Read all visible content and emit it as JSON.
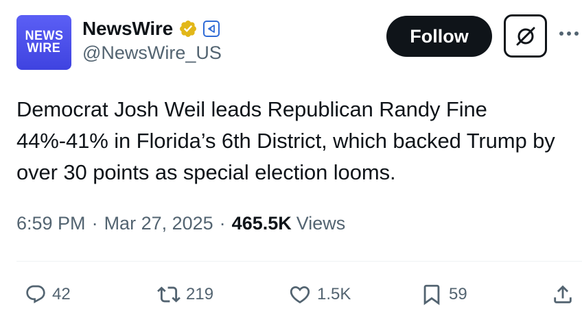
{
  "account": {
    "avatar_line1": "NEWS",
    "avatar_line2": "WIRE",
    "display_name": "NewsWire",
    "handle": "@NewsWire_US",
    "verified_badge": "gold-check-icon",
    "affiliate_badge": "affiliate-icon"
  },
  "header": {
    "follow_label": "Follow",
    "grok_icon": "grok-icon",
    "more_icon": "more-icon"
  },
  "tweet": {
    "text": "Democrat Josh Weil leads Republican Randy Fine 44%-41% in Florida’s 6th District, which backed Trump by over 30 points as special election looms.",
    "time": "6:59 PM",
    "separator": "·",
    "date": "Mar 27, 2025",
    "views_count": "465.5K",
    "views_label": "Views"
  },
  "actions": {
    "replies": "42",
    "reposts": "219",
    "likes": "1.5K",
    "bookmarks": "59"
  },
  "colors": {
    "primary_text": "#0f1419",
    "secondary_text": "#536471",
    "avatar_blue": "#4a4eec",
    "verified_gold": "#e2b719",
    "affiliate_blue": "#2f6bd6"
  }
}
